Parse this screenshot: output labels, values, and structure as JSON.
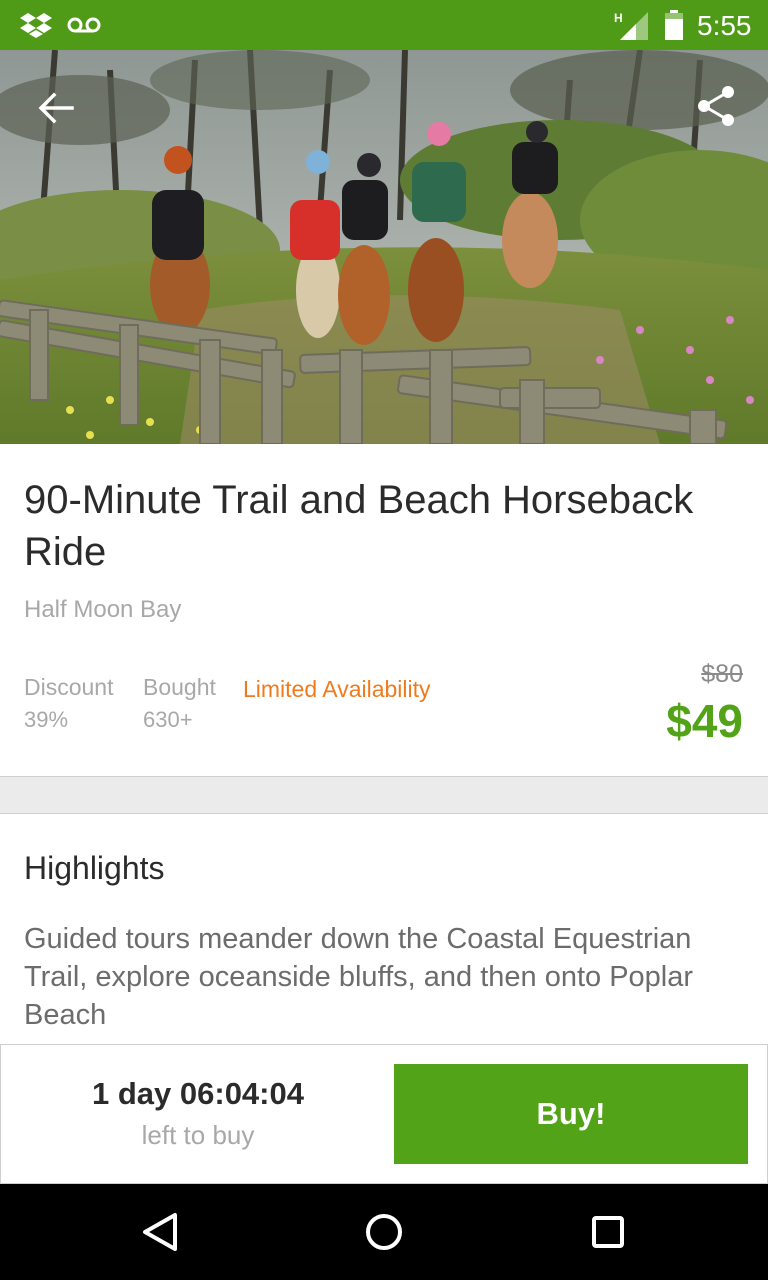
{
  "status_bar": {
    "time": "5:55",
    "network_label": "H",
    "icons": [
      "dropbox-icon",
      "voicemail-icon",
      "signal-icon",
      "battery-icon"
    ]
  },
  "hero": {
    "image_description": "horseback-riders-trail-photo",
    "icons": [
      "back-arrow-icon",
      "share-icon"
    ]
  },
  "deal": {
    "title": "90-Minute Trail and Beach Horseback Ride",
    "location": "Half Moon Bay",
    "discount_label": "Discount",
    "discount_value": "39%",
    "bought_label": "Bought",
    "bought_value": "630+",
    "availability": "Limited Availability",
    "original_price": "$80",
    "price": "$49"
  },
  "highlights": {
    "heading": "Highlights",
    "text": "Guided tours meander down the Coastal Equestrian Trail, explore oceanside bluffs, and then onto Poplar Beach"
  },
  "buy_bar": {
    "countdown": "1 day 06:04:04",
    "countdown_suffix": "left to buy",
    "buy_label": "Buy!"
  },
  "nav_bar": {
    "icons": [
      "back-triangle-icon",
      "home-circle-icon",
      "recents-square-icon"
    ]
  },
  "colors": {
    "brand_green": "#53a318",
    "status_green": "#4f9a17",
    "availability_orange": "#f07b1e",
    "muted_text": "#a8a8a8"
  }
}
